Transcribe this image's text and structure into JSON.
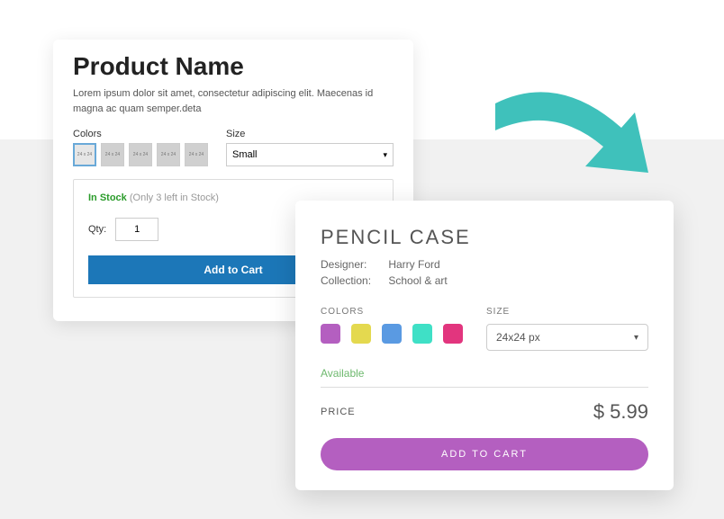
{
  "cardA": {
    "title": "Product Name",
    "description": "Lorem ipsum dolor sit amet, consectetur adipiscing elit. Maecenas id magna ac quam semper.deta",
    "colors_label": "Colors",
    "size_label": "Size",
    "size_value": "Small",
    "swatch_text": "24 x 24",
    "stock_status": "In Stock",
    "stock_note": "(Only 3 left in Stock)",
    "qty_label": "Qty:",
    "qty_value": "1",
    "add_label": "Add to Cart"
  },
  "cardB": {
    "title": "PENCIL CASE",
    "designer_k": "Designer:",
    "designer_v": "Harry Ford",
    "collection_k": "Collection:",
    "collection_v": "School & art",
    "colors_label": "COLORS",
    "size_label": "SIZE",
    "size_value": "24x24 px",
    "colors": [
      "#b45fc0",
      "#e4d94f",
      "#5a9ae2",
      "#3fe0c6",
      "#e2357e"
    ],
    "available": "Available",
    "price_label": "PRICE",
    "price_value": "$ 5.99",
    "add_label": "ADD TO CART"
  }
}
